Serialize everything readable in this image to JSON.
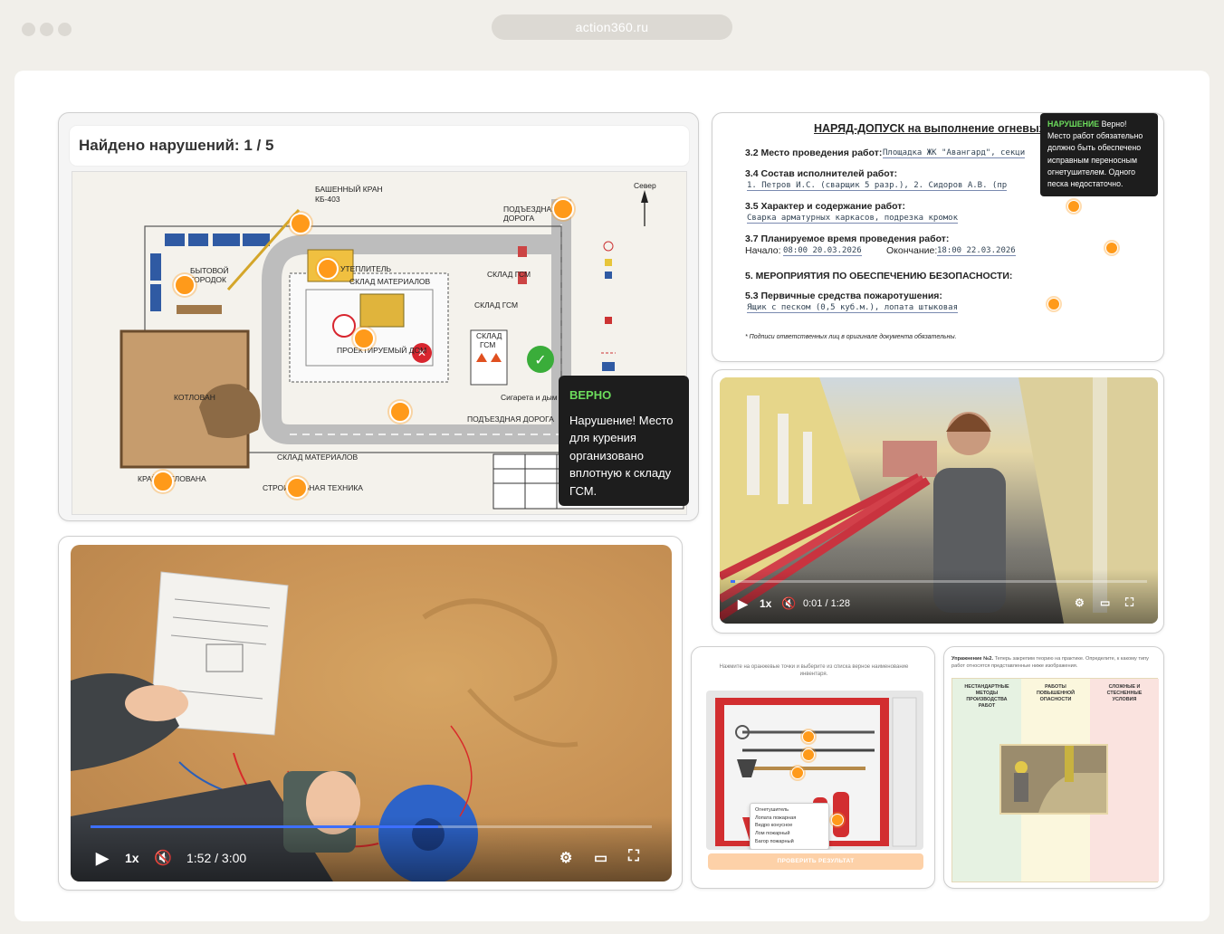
{
  "browser": {
    "url": "action360.ru"
  },
  "plan_card": {
    "title": "Найдено нарушений: 1 / 5",
    "labels": {
      "crane": "БАШЕННЫЙ КРАН",
      "crane_model": "КБ-403",
      "access_road_top": "ПОДЪЕЗДНАЯ",
      "access_road_top2": "ДОРОГА",
      "north": "Север",
      "insulation": "УТЕПЛИТЕЛЬ",
      "material_store": "СКЛАД МАТЕРИАЛОВ",
      "town": "БЫТОВОЙ",
      "town2": "ГОРОДОК",
      "gsm_store": "СКЛАД ГСМ",
      "gsm_store2": "СКЛАД ГСМ",
      "gsm_store3a": "СКЛАД",
      "gsm_store3b": "ГСМ",
      "pit": "КОТЛОВАН",
      "projected": "ПРОЕКТИРУЕМЫЙ ДОМ",
      "smoking": "Сигарета и дым",
      "access_road_bottom": "ПОДЪЕЗДНАЯ ДОРОГА",
      "materials_bottom": "СКЛАД МАТЕРИАЛОВ",
      "pit_edge": "КРАЙ КОТЛОВАНА",
      "construction_equipment": "СТРОИТЕЛЬНАЯ ТЕХНИКА"
    },
    "tooltip": {
      "status": "ВЕРНО",
      "text": "Нарушение! Место для курения организовано вплотную к складу ГСМ."
    }
  },
  "doc_card": {
    "title": "НАРЯД-ДОПУСК на выполнение огневых ра",
    "r1_label": "3.2 Место проведения работ:",
    "r1_value": "Площадка ЖК \"Авангард\", секци",
    "r2_label": "3.4 Состав исполнителей работ:",
    "r2_value": "1. Петров И.С. (сварщик 5 разр.), 2. Сидоров А.В. (пр",
    "r3_label": "3.5 Характер и содержание работ:",
    "r3_value": "Сварка арматурных каркасов, подрезка кромок",
    "r4_label": "3.7 Планируемое время проведения работ:",
    "r4_start": "Начало:",
    "r4_start_val": "08:00 20.03.2026",
    "r4_end": "Окончание:",
    "r4_end_val": "18:00 22.03.2026",
    "r5_label": "5. МЕРОПРИЯТИЯ ПО ОБЕСПЕЧЕНИЮ БЕЗОПАСНОСТИ:",
    "r6_label": "5.3 Первичные средства пожаротушения:",
    "r6_value": "Ящик с песком (0,5 куб.м.), лопата штыковая",
    "footnote": "* Подписи ответственных лиц в оригинале документа обязательны.",
    "tooltip_status": "НАРУШЕНИЕ",
    "tooltip_verdict": "Верно!",
    "tooltip_text": "Место работ обязательно должно быть обеспечено исправным переносным огнетушителем. Одного песка недостаточно."
  },
  "video_street": {
    "speed": "1x",
    "time": "0:01 / 1:28",
    "progress": 0.01
  },
  "video_sand": {
    "speed": "1x",
    "time": "1:52 / 3:00",
    "progress": 0.62
  },
  "shield_card": {
    "instruction": "Нажмите на оранжевые точки и выберите из списка верное наименование инвентаря.",
    "options": [
      "Огнетушитель",
      "Лопата пожарная",
      "Ведро конусное",
      "Лом пожарный",
      "Багор пожарный"
    ],
    "check_button": "ПРОВЕРИТЬ РЕЗУЛЬТАТ"
  },
  "sort_card": {
    "exercise_label": "Упражнение №2.",
    "instruction": "Теперь закрепим теорию на практике. Определите, к какому типу работ относятся представленные ниже изображения.",
    "columns": [
      "НЕСТАНДАРТНЫЕ МЕТОДЫ ПРОИЗВОДСТВА РАБОТ",
      "РАБОТЫ ПОВЫШЕННОЙ ОПАСНОСТИ",
      "СЛОЖНЫЕ И СТЕСНЕННЫЕ УСЛОВИЯ"
    ]
  },
  "colors": {
    "accent": "#ff9a1a",
    "ok": "#6cdc5c",
    "tooltip_bg": "#1d1d1d"
  }
}
